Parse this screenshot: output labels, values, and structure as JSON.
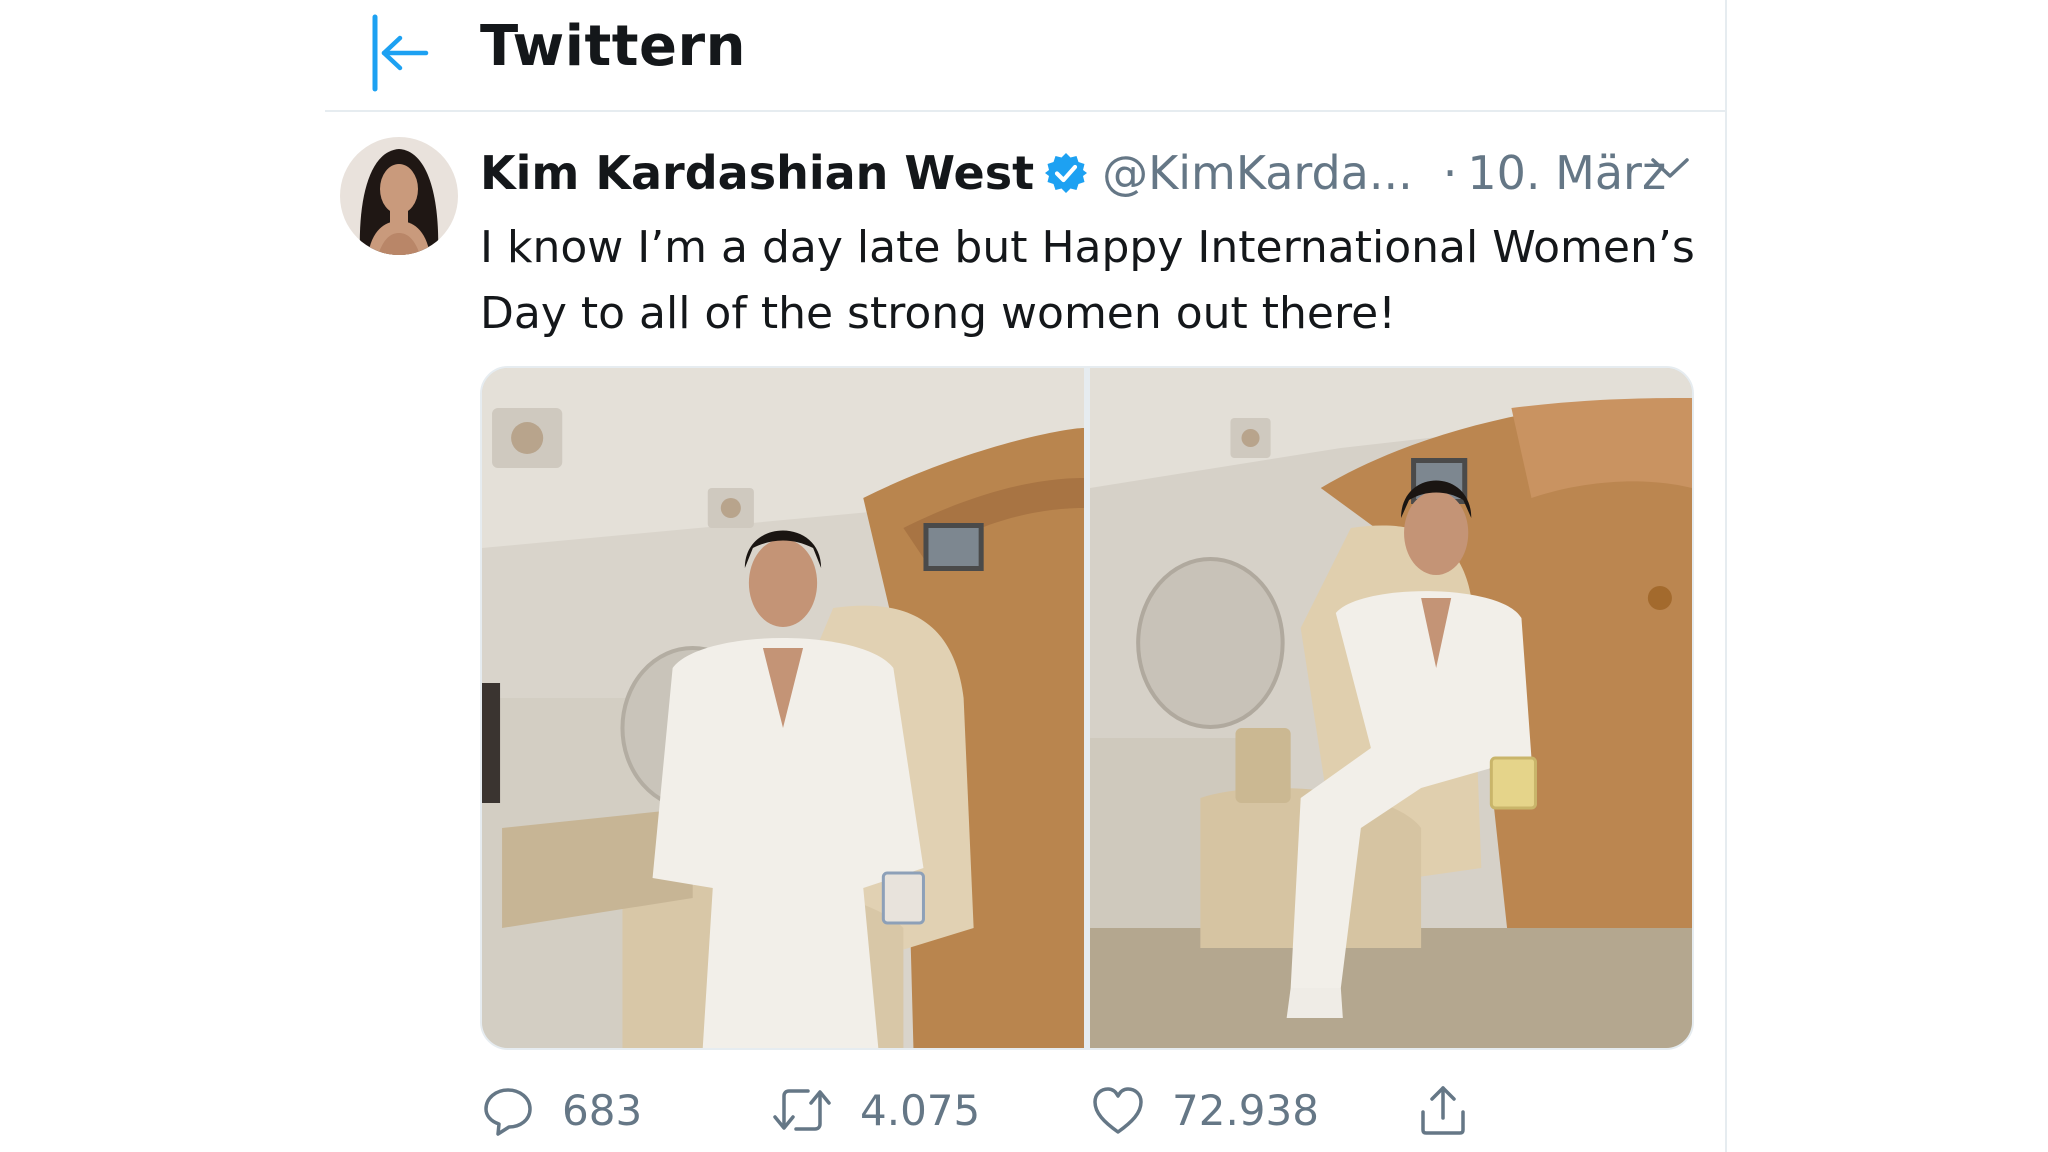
{
  "header": {
    "title": "Twittern"
  },
  "tweet": {
    "author": {
      "display_name": "Kim Kardashian West",
      "handle": "@KimKarda...",
      "verified": true
    },
    "separator": "·",
    "date": "10. März",
    "text": "I know I’m a day late but Happy International Women’s Day to all of the strong women out there!",
    "photos": [
      {
        "description": "woman-in-white-suit-seated-in-jet-cabin"
      },
      {
        "description": "woman-in-white-suit-seated-in-jet-cabin-legs-crossed"
      }
    ],
    "stats": {
      "replies": "683",
      "retweets": "4.075",
      "likes": "72.938"
    }
  },
  "icons": {
    "back": "back-arrow-icon",
    "verified": "verified-badge-icon",
    "caret": "chevron-down-icon",
    "reply": "reply-icon",
    "retweet": "retweet-icon",
    "like": "heart-icon",
    "share": "share-icon"
  },
  "colors": {
    "accent": "#1da1f2",
    "text": "#14171a",
    "muted": "#657786",
    "border": "#e6ecf0"
  }
}
